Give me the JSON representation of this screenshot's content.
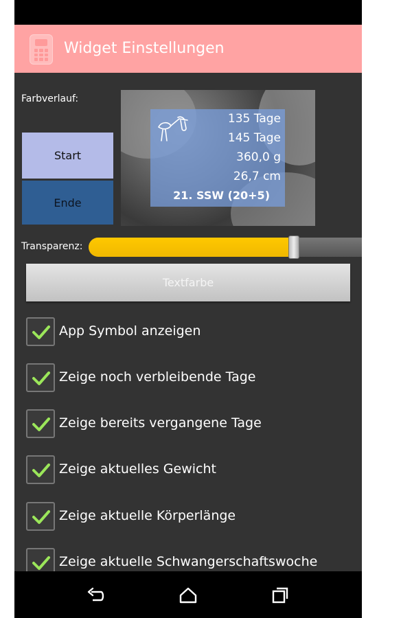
{
  "app_bar": {
    "title": "Widget Einstellungen"
  },
  "gradient": {
    "label": "Farbverlauf:",
    "start_label": "Start",
    "end_label": "Ende",
    "start_color": "#B4BBE8",
    "end_color": "#2F5E93"
  },
  "preview": {
    "remaining_days": "135 Tage",
    "elapsed_days": "145 Tage",
    "weight": "360,0 g",
    "length": "26,7 cm",
    "week": "21. SSW (20+5)"
  },
  "transparency": {
    "label": "Transparenz:",
    "value_percent": 75,
    "fill_color": "#FFC800"
  },
  "text_color_button": {
    "label": "Textfarbe"
  },
  "checkboxes": [
    {
      "label": "App Symbol anzeigen",
      "checked": true
    },
    {
      "label": "Zeige noch verbleibende Tage",
      "checked": true
    },
    {
      "label": "Zeige bereits vergangene Tage",
      "checked": true
    },
    {
      "label": "Zeige aktuelles Gewicht",
      "checked": true
    },
    {
      "label": "Zeige aktuelle Körperlänge",
      "checked": true
    },
    {
      "label": "Zeige aktuelle Schwangerschaftswoche",
      "checked": true
    }
  ],
  "colors": {
    "app_bar": "#FFA3A3",
    "background": "#333333",
    "check": "#9BE65A"
  },
  "nav": {
    "icons": [
      "back-icon",
      "home-icon",
      "recents-icon"
    ]
  }
}
